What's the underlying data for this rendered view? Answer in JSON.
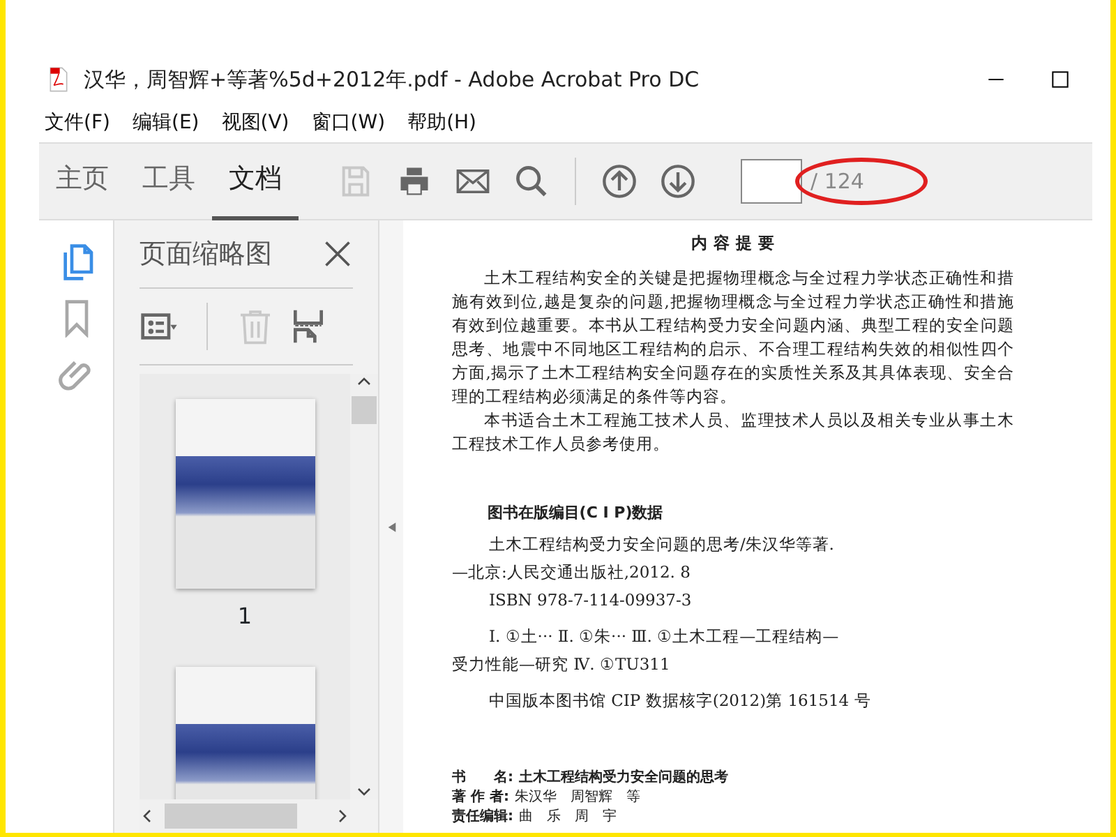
{
  "window": {
    "title": "汉华，周智辉+等著%5d+2012年.pdf - Adobe Acrobat Pro DC"
  },
  "menu": [
    "文件(F)",
    "编辑(E)",
    "视图(V)",
    "窗口(W)",
    "帮助(H)"
  ],
  "tabs": [
    {
      "label": "主页",
      "selected": false
    },
    {
      "label": "工具",
      "selected": false
    },
    {
      "label": "文档",
      "selected": true
    }
  ],
  "toolbar": {
    "tools": [
      {
        "kind": "save",
        "disabled": true
      },
      {
        "kind": "print",
        "disabled": false
      },
      {
        "kind": "mail",
        "disabled": false
      },
      {
        "kind": "search",
        "disabled": false
      },
      {
        "kind": "sep"
      },
      {
        "kind": "up",
        "disabled": false
      },
      {
        "kind": "down",
        "disabled": false
      }
    ],
    "page_total": "/ 124",
    "page_total_circled": true
  },
  "sidebar": {
    "items": [
      {
        "kind": "pages",
        "selected": true
      },
      {
        "kind": "bookmark",
        "selected": false
      },
      {
        "kind": "attach",
        "selected": false
      }
    ]
  },
  "thumbnail_panel": {
    "title": "页面缩略图",
    "tools": [
      {
        "kind": "options",
        "disabled": false
      },
      {
        "kind": "trash",
        "disabled": true
      },
      {
        "kind": "insert",
        "disabled": false
      }
    ],
    "thumbnails": [
      {
        "kind": "page",
        "label": "1"
      },
      {
        "kind": "page"
      }
    ]
  },
  "document": {
    "heading": "内 容 提 要",
    "paragraphs": [
      "土木工程结构安全的关键是把握物理概念与全过程力学状态正确性和措施有效到位,越是复杂的问题,把握物理概念与全过程力学状态正确性和措施有效到位越重要。本书从工程结构受力安全问题内涵、典型工程的安全问题思考、地震中不同地区工程结构的启示、不合理工程结构失效的相似性四个方面,揭示了土木工程结构安全问题存在的实质性关系及其具体表现、安全合理的工程结构必须满足的条件等内容。",
      "本书适合土木工程施工技术人员、监理技术人员以及相关专业从事土木工程技术工作人员参考使用。"
    ],
    "cip_heading": "图书在版编目(C I P)数据",
    "cip_lines": [
      {
        "kind": "indent",
        "text": "土木工程结构受力安全问题的思考/朱汉华等著."
      },
      {
        "kind": "flush",
        "text": "—北京:人民交通出版社,2012. 8"
      },
      {
        "kind": "indent",
        "text": "ISBN  978-7-114-09937-3"
      },
      {
        "kind": "gap",
        "text": "Ⅰ. ①土···  Ⅱ. ①朱···  Ⅲ. ①土木工程—工程结构—"
      },
      {
        "kind": "flush",
        "text": "受力性能—研究  Ⅳ. ①TU311"
      },
      {
        "kind": "gapindent",
        "text": "中国版本图书馆 CIP 数据核字(2012)第 161514 号"
      }
    ],
    "credits": [
      {
        "label": "书　　名:",
        "value": "土木工程结构受力安全问题的思考",
        "bold_value": true
      },
      {
        "label": "著 作 者:",
        "value": "朱汉华　周智辉　等",
        "bold_value": false
      },
      {
        "label": "责任编辑:",
        "value": "曲　乐　周　宇",
        "bold_value": false
      }
    ]
  }
}
